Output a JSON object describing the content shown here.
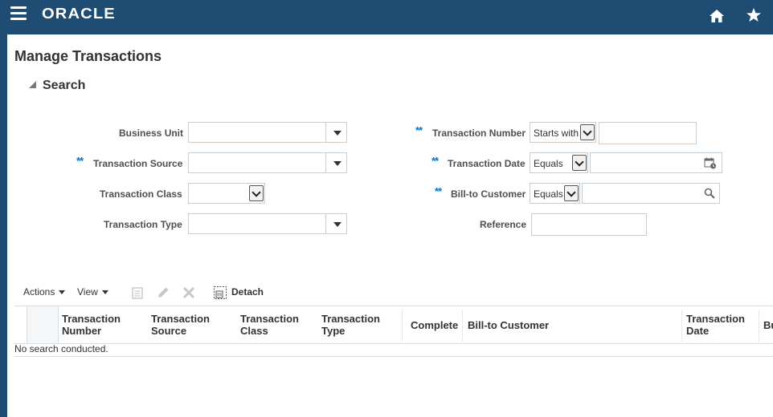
{
  "header": {
    "logo": "ORACLE"
  },
  "page": {
    "title": "Manage Transactions"
  },
  "search": {
    "header": "Search",
    "fields": {
      "business_unit": {
        "label": "Business Unit",
        "value": ""
      },
      "transaction_source": {
        "label": "Transaction Source",
        "value": "",
        "required_marker": "**"
      },
      "transaction_class": {
        "label": "Transaction Class",
        "value": ""
      },
      "transaction_type": {
        "label": "Transaction Type",
        "value": ""
      },
      "transaction_number": {
        "label": "Transaction Number",
        "operator": "Starts with",
        "value": "",
        "required_marker": "**"
      },
      "transaction_date": {
        "label": "Transaction Date",
        "operator": "Equals",
        "value": "",
        "required_marker": "**"
      },
      "bill_to_customer": {
        "label": "Bill-to Customer",
        "operator": "Equals",
        "value": "",
        "required_marker": "**"
      },
      "reference": {
        "label": "Reference",
        "value": ""
      }
    }
  },
  "toolbar": {
    "actions": "Actions",
    "view": "View",
    "detach": "Detach"
  },
  "table": {
    "columns": [
      {
        "line1": "Transaction",
        "line2": "Number"
      },
      {
        "line1": "Transaction",
        "line2": "Source"
      },
      {
        "line1": "Transaction",
        "line2": "Class"
      },
      {
        "line1": "Transaction",
        "line2": "Type"
      },
      {
        "line1": "Complete",
        "line2": ""
      },
      {
        "line1": "Bill-to Customer",
        "line2": ""
      },
      {
        "line1": "Transaction",
        "line2": "Date"
      },
      {
        "line1": "Bu",
        "line2": ""
      }
    ],
    "empty_message": "No search conducted."
  },
  "colors": {
    "brand_bar": "#1f4c72",
    "required": "#0572ce"
  }
}
